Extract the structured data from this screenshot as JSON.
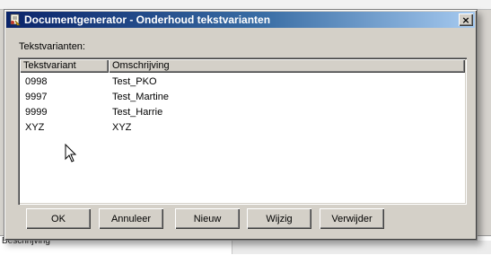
{
  "window": {
    "title": "Documentgenerator - Onderhoud tekstvarianten",
    "close_glyph": "×"
  },
  "listview": {
    "caption": "Tekstvarianten:",
    "columns": [
      "Tekstvariant",
      "Omschrijving"
    ],
    "rows": [
      [
        "0998",
        "Test_PKO"
      ],
      [
        "9997",
        "Test_Martine"
      ],
      [
        "9999",
        "Test_Harrie"
      ],
      [
        "XYZ",
        "XYZ"
      ]
    ]
  },
  "buttons": {
    "ok": "OK",
    "cancel": "Annuleer",
    "new": "Nieuw",
    "edit": "Wijzig",
    "delete": "Verwijder"
  },
  "background": {
    "bottom_left_text": "Beschrijving"
  },
  "icons": {
    "app": "document-generator-icon",
    "close": "close-icon",
    "cursor": "mouse-pointer-icon"
  },
  "colors": {
    "titlebar_start": "#0a246a",
    "titlebar_end": "#a6caf0",
    "face": "#d4d0c8"
  }
}
